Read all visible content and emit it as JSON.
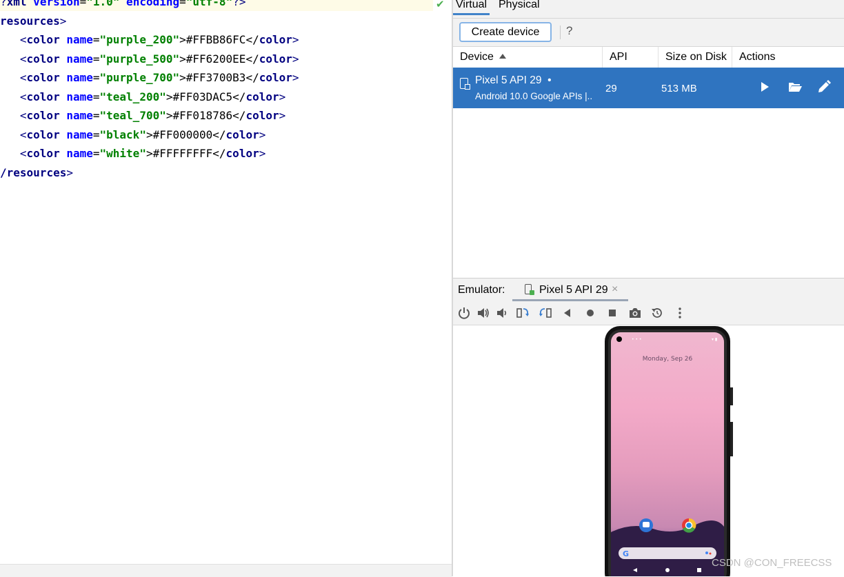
{
  "editor": {
    "lines": [
      {
        "pre": "?",
        "tag": "xml",
        "a1": " version",
        "v1": "\"1.0\"",
        "a2": " encoding",
        "v2": "\"utf-8\"",
        "post": "?>"
      },
      {
        "tag": "resources",
        "post": ">"
      },
      {
        "indent": "   <",
        "tag": "color",
        "attr": " name",
        "eq": "=",
        "val": "\"purple_200\"",
        "text": ">#FFBB86FC</",
        "ctag": "color",
        "end": ">"
      },
      {
        "indent": "   <",
        "tag": "color",
        "attr": " name",
        "eq": "=",
        "val": "\"purple_500\"",
        "text": ">#FF6200EE</",
        "ctag": "color",
        "end": ">"
      },
      {
        "indent": "   <",
        "tag": "color",
        "attr": " name",
        "eq": "=",
        "val": "\"purple_700\"",
        "text": ">#FF3700B3</",
        "ctag": "color",
        "end": ">"
      },
      {
        "indent": "   <",
        "tag": "color",
        "attr": " name",
        "eq": "=",
        "val": "\"teal_200\"",
        "text": ">#FF03DAC5</",
        "ctag": "color",
        "end": ">"
      },
      {
        "indent": "   <",
        "tag": "color",
        "attr": " name",
        "eq": "=",
        "val": "\"teal_700\"",
        "text": ">#FF018786</",
        "ctag": "color",
        "end": ">"
      },
      {
        "indent": "   <",
        "tag": "color",
        "attr": " name",
        "eq": "=",
        "val": "\"black\"",
        "text": ">#FF000000</",
        "ctag": "color",
        "end": ">"
      },
      {
        "indent": "   <",
        "tag": "color",
        "attr": " name",
        "eq": "=",
        "val": "\"white\"",
        "text": ">#FFFFFFFF</",
        "ctag": "color",
        "end": ">"
      },
      {
        "pre": "/",
        "tag": "resources",
        "post": ">"
      }
    ],
    "line1": {
      "q": "?",
      "tag": "xml",
      "a1": " version",
      "eq1": "=",
      "v1": "\"1.0\"",
      "a2": " encoding",
      "eq2": "=",
      "v2": "\"utf-8\"",
      "end": "?>"
    },
    "line2": {
      "tag": "resources",
      "end": ">"
    },
    "line10": {
      "slash": "/",
      "tag": "resources",
      "end": ">"
    }
  },
  "device_manager": {
    "tabs": [
      "Virtual",
      "Physical"
    ],
    "create_button": "Create device",
    "help": "?",
    "columns": {
      "device": "Device",
      "api": "API",
      "size": "Size on Disk",
      "actions": "Actions"
    },
    "row": {
      "name": "Pixel 5 API 29",
      "dot": "•",
      "subtitle": "Android 10.0 Google APIs |...",
      "api": "29",
      "size": "513 MB"
    }
  },
  "emulator": {
    "label": "Emulator:",
    "tab_name": "Pixel 5 API 29",
    "close": "×",
    "date": "Monday, Sep 26"
  },
  "watermark": "CSDN @CON_FREECSS",
  "colors": {
    "accent": "#2f74c0",
    "tag": "#000080",
    "attr": "#0000ff",
    "value": "#008000"
  }
}
